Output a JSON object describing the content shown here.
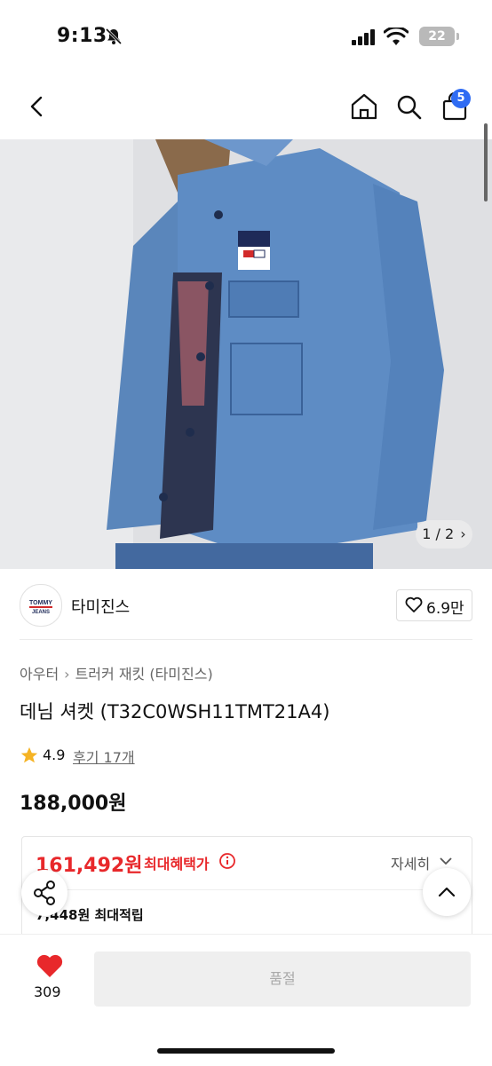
{
  "status_bar": {
    "time": "9:13",
    "battery": "22"
  },
  "header": {
    "cart_count": "5"
  },
  "gallery": {
    "counter": "1 / 2"
  },
  "brand": {
    "name": "타미진스",
    "logo_text_line1": "TOMMY",
    "logo_text_line2": "JEANS"
  },
  "likes": {
    "count": "6.9만"
  },
  "breadcrumb": {
    "items": [
      "아우터",
      "트러커 재킷 (타미진스)"
    ]
  },
  "product": {
    "title": "데님 셔켓 (T32C0WSH11TMT21A4)",
    "rating": "4.9",
    "review_link": "후기 17개",
    "price": "188,000원"
  },
  "benefit": {
    "sale_price": "161,492원",
    "sale_label": "최대혜택가",
    "detail_link": "자세히",
    "points": "7,448원 최대적립"
  },
  "bottom": {
    "wish_count": "309",
    "action_button": "품절"
  },
  "colors": {
    "accent_red": "#e8282b",
    "badge_blue": "#2f6cf3"
  }
}
